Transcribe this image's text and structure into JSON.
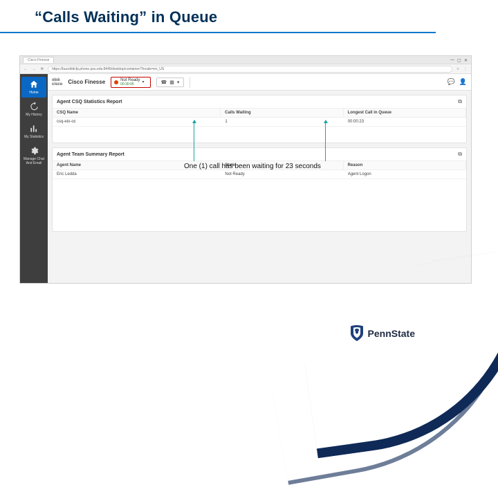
{
  "slide": {
    "title": "“Calls Waiting” in Queue"
  },
  "caption": "One (1) call has been waiting for 23 seconds",
  "brand": "PennState",
  "browser": {
    "tab": "Cisco Finesse",
    "url": "https://buzzbldcfp.phone.psu.edu:8445/desktop/container/?locale=en_US",
    "win": {
      "min": "—",
      "max": "▢",
      "close": "✕"
    }
  },
  "topbar": {
    "cisco": "cisco",
    "product": "Cisco Finesse",
    "status": {
      "label": "Not Ready",
      "time": "00:30:05"
    }
  },
  "sidebar": [
    {
      "key": "home",
      "label": "Home"
    },
    {
      "key": "history",
      "label": "My History"
    },
    {
      "key": "stats",
      "label": "My Statistics"
    },
    {
      "key": "manage",
      "label": "Manage Chat And Email"
    }
  ],
  "panel1": {
    "title": "Agent CSQ Statistics Report",
    "headers": [
      "CSQ Name",
      "Calls Waiting",
      "Longest Call in Queue"
    ],
    "rows": [
      {
        "a": "csq-eio-oc",
        "b": "1",
        "c": "00:00:23"
      }
    ]
  },
  "panel2": {
    "title": "Agent Team Summary Report",
    "headers": [
      "Agent Name",
      "State",
      "Reason"
    ],
    "rows": [
      {
        "a": "Eric Ledda",
        "b": "Not Ready",
        "c": "Agent Logon"
      }
    ]
  }
}
